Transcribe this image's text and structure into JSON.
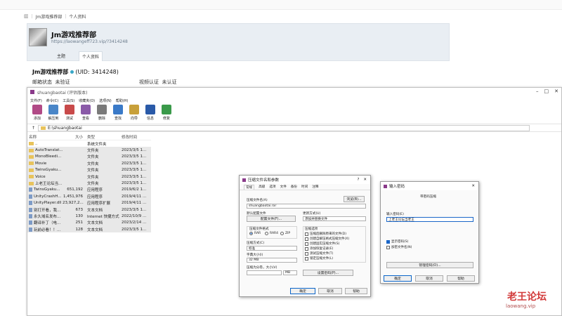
{
  "page": {
    "breadcrumb": [
      "Jm游戏推荐部",
      "个人资料"
    ],
    "profile": {
      "name": "Jm游戏推荐部",
      "url": "https://laowangeff723.vip/?3414248",
      "tabs": [
        "主题",
        "个人资料"
      ],
      "uid_text": "(UID: 3414248)",
      "email_label": "邮箱状态",
      "email_value": "未验证",
      "video_label": "视频认证",
      "video_value": "未认证"
    }
  },
  "app": {
    "title": "shuangbaotai (评估版本)",
    "menu": [
      "文件(F)",
      "命令(C)",
      "工具(S)",
      "收藏夹(O)",
      "选项(N)",
      "帮助(H)"
    ],
    "tools": [
      {
        "label": "添加",
        "icon": "add-icon",
        "color": "#b14a86"
      },
      {
        "label": "解压到",
        "icon": "extract-icon",
        "color": "#4a86c8"
      },
      {
        "label": "测试",
        "icon": "test-icon",
        "color": "#c84a4a"
      },
      {
        "label": "查看",
        "icon": "view-icon",
        "color": "#8a5aa8"
      },
      {
        "label": "删除",
        "icon": "delete-icon",
        "color": "#7a7a7a"
      },
      {
        "label": "查找",
        "icon": "find-icon",
        "color": "#3a7ac8"
      },
      {
        "label": "向导",
        "icon": "wizard-icon",
        "color": "#c8a03a"
      },
      {
        "label": "信息",
        "icon": "info-icon",
        "color": "#2a5aa8"
      },
      {
        "label": "修复",
        "icon": "repair-icon",
        "color": "#3a9a4a"
      }
    ],
    "path": "E:\\shuangbaotai",
    "columns": [
      "名称",
      "大小",
      "类型",
      "修改时间"
    ],
    "files": [
      {
        "name": "..",
        "size": "",
        "type": "系统文件夹",
        "date": "",
        "folder": true
      },
      {
        "name": "AutoTranslat...",
        "size": "",
        "type": "文件夹",
        "date": "2023/3/5 1...",
        "folder": true
      },
      {
        "name": "MonoBleedi...",
        "size": "",
        "type": "文件夹",
        "date": "2023/3/5 1...",
        "folder": true
      },
      {
        "name": "Movie",
        "size": "",
        "type": "文件夹",
        "date": "2023/3/5 1...",
        "folder": true
      },
      {
        "name": "TwinsGyaku...",
        "size": "",
        "type": "文件夹",
        "date": "2023/3/5 1...",
        "folder": true
      },
      {
        "name": "Voice",
        "size": "",
        "type": "文件夹",
        "date": "2023/3/5 1...",
        "folder": true
      },
      {
        "name": "上老王论坛当...",
        "size": "",
        "type": "文件夹",
        "date": "2023/3/5 1...",
        "folder": true
      },
      {
        "name": "TwinsGyaku...",
        "size": "651,192",
        "type": "应用程序",
        "date": "2019/6/2 1...",
        "folder": false
      },
      {
        "name": "UnityCrashH...",
        "size": "1,451,976",
        "type": "应用程序",
        "date": "2019/4/11 ...",
        "folder": false
      },
      {
        "name": "UnityPlayer.dll",
        "size": "23,927,2...",
        "type": "应用程序扩展",
        "date": "2019/4/11 ...",
        "folder": false
      },
      {
        "name": "别打开看，我...",
        "size": "673",
        "type": "文本文档",
        "date": "2023/3/5 1...",
        "folder": false
      },
      {
        "name": "永久域名发布...",
        "size": "130",
        "type": "Internet 快捷方式",
        "date": "2022/10/9 ...",
        "folder": false
      },
      {
        "name": "翻译补丁（电...",
        "size": "251",
        "type": "文本文档",
        "date": "2023/2/14 ...",
        "folder": false
      },
      {
        "name": "玩前必看！！...",
        "size": "128",
        "type": "文本文档",
        "date": "2023/3/5 1...",
        "folder": false
      }
    ]
  },
  "dialog1": {
    "title": "压缩文件名和参数",
    "tabs": [
      "常规",
      "高级",
      "选项",
      "文件",
      "备份",
      "时间",
      "注释"
    ],
    "archive_name_label": "压缩文件名(A)",
    "browse": "浏览(B)...",
    "archive_name": "shuangbaotai.rar",
    "profile_label": "默认配置文件",
    "profile_btn": "配置文件(F)...",
    "update_label": "更新方式(U)",
    "update_value": "添加并替换文件",
    "format_label": "压缩文件格式",
    "formats": [
      "RAR",
      "RAR4",
      "ZIP"
    ],
    "options_label": "压缩选项",
    "options": [
      "压缩后删除原来的文件(D)",
      "创建自解压格式压缩文件(X)",
      "创建固实压缩文件(S)",
      "添加恢复记录(E)",
      "测试压缩文件(T)",
      "锁定压缩文件(L)"
    ],
    "method_label": "压缩方式(C)",
    "method_value": "标准",
    "dict_label": "字典大小(I)",
    "dict_value": "32 MB",
    "split_label": "压缩为分卷，大小(V)",
    "split_unit": "MB",
    "password_btn": "设置密码(P)...",
    "ok": "确定",
    "cancel": "取消",
    "help": "帮助"
  },
  "dialog2": {
    "title": "输入密码",
    "subtitle": "带密码压缩",
    "pwd_label": "输入密码(E)",
    "pwd_value": "上老王论坛当老王",
    "show_pwd": "显示密码(S)",
    "encrypt_names": "加密文件名(N)",
    "manage": "管理密码(O)...",
    "ok": "确定",
    "cancel": "取消",
    "help": "帮助"
  },
  "watermark": {
    "text": "老王论坛",
    "sub": "laowang.vip"
  }
}
